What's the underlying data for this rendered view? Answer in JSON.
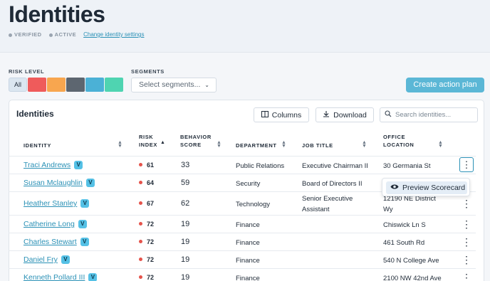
{
  "page": {
    "title": "Identities",
    "status": [
      "VERIFIED",
      "ACTIVE"
    ],
    "settings_link": "Change identity settings"
  },
  "filters": {
    "risk_label": "RISK LEVEL",
    "risk_all": "All",
    "risk_colors": [
      "#ef5b5b",
      "#f8a64f",
      "#5d6670",
      "#4bb1d6",
      "#4fd4b1"
    ],
    "segments_label": "SEGMENTS",
    "segments_placeholder": "Select segments..."
  },
  "actions": {
    "create_plan": "Create action plan"
  },
  "table": {
    "title": "Identities",
    "columns_btn": "Columns",
    "download_btn": "Download",
    "search_placeholder": "Search identities...",
    "headers": {
      "identity": "IDENTITY",
      "risk_index_1": "RISK",
      "risk_index_2": "INDEX",
      "behavior_1": "BEHAVIOR",
      "behavior_2": "SCORE",
      "department": "DEPARTMENT",
      "job_title": "JOB TITLE",
      "office_1": "OFFICE",
      "office_2": "LOCATION"
    },
    "badge": "V",
    "rows": [
      {
        "name": "Traci Andrews",
        "risk": "61",
        "score": "33",
        "dept": "Public Relations",
        "job": "Executive Chairman II",
        "office": "30 Germania St"
      },
      {
        "name": "Susan Mclaughlin",
        "risk": "64",
        "score": "59",
        "dept": "Security",
        "job": "Board of Directors II",
        "office": ""
      },
      {
        "name": "Heather Stanley",
        "risk": "67",
        "score": "62",
        "dept": "Technology",
        "job": "Senior Executive",
        "job2": "Assistant",
        "office": "12190 NE District",
        "office2": "Wy"
      },
      {
        "name": "Catherine Long",
        "risk": "72",
        "score": "19",
        "dept": "Finance",
        "job": "",
        "office": "Chiswick Ln S"
      },
      {
        "name": "Charles Stewart",
        "risk": "72",
        "score": "19",
        "dept": "Finance",
        "job": "",
        "office": "461 South Rd"
      },
      {
        "name": "Daniel Fry",
        "risk": "72",
        "score": "19",
        "dept": "Finance",
        "job": "",
        "office": "540 N College Ave"
      },
      {
        "name": "Kenneth Pollard III",
        "risk": "72",
        "score": "19",
        "dept": "Finance",
        "job": "",
        "office": "2100 NW 42nd Ave"
      }
    ],
    "menu_item": "Preview Scorecard"
  }
}
